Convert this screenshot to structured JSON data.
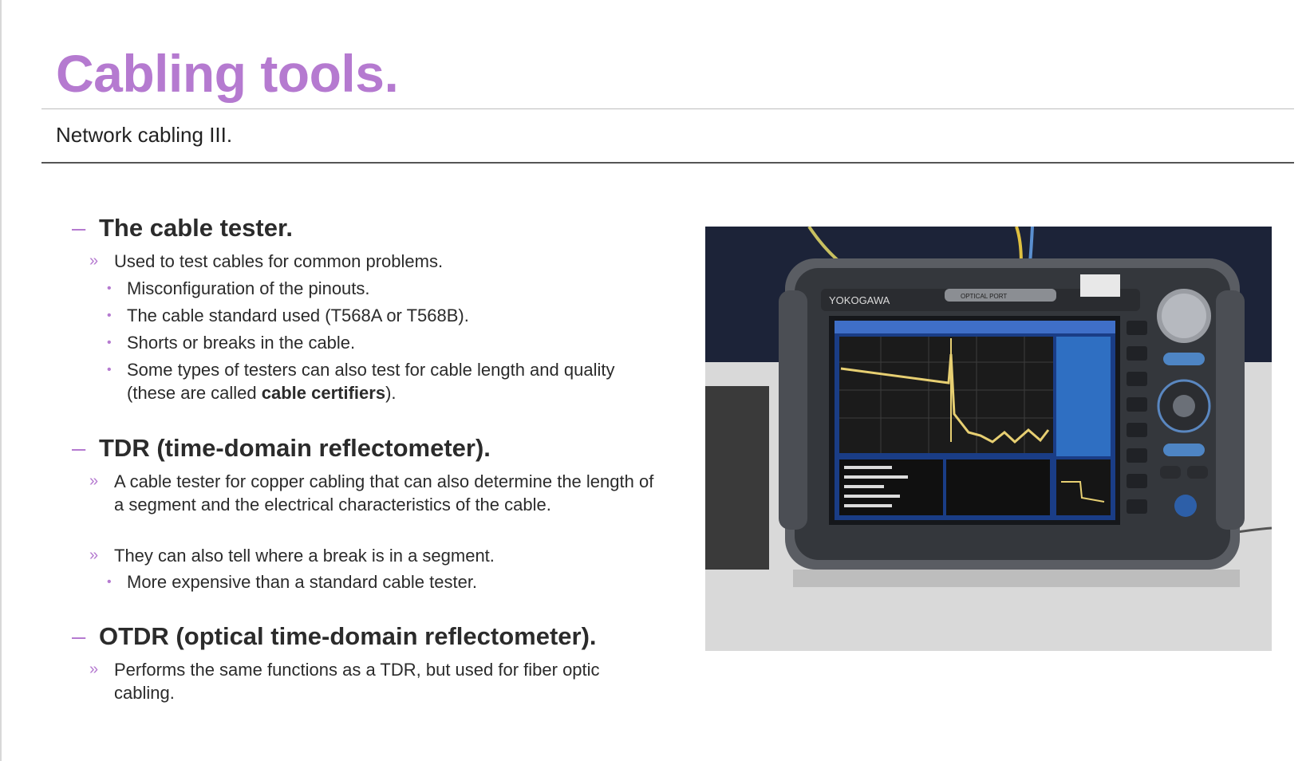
{
  "slide": {
    "title": "Cabling tools.",
    "subtitle": "Network cabling III."
  },
  "sections": [
    {
      "heading": "The cable tester.",
      "items": [
        {
          "text": "Used to test cables for common problems."
        },
        {
          "text": "Misconfiguration of the pinouts."
        },
        {
          "text": "The cable standard used (T568A or T568B)."
        },
        {
          "text": "Shorts or breaks in the cable."
        },
        {
          "text_before": "Some types of testers can also test for cable length and quality (these are called ",
          "text_bold": "cable certifiers",
          "text_after": ")."
        }
      ]
    },
    {
      "heading": "TDR (time-domain reflectometer).",
      "items": [
        {
          "text": "A cable tester for copper cabling that can also determine the length of a segment and the electrical characteristics of the cable."
        },
        {
          "text": "They can also tell where a break is in a segment."
        },
        {
          "text": "More expensive than a standard cable tester."
        }
      ]
    },
    {
      "heading": "OTDR (optical time-domain reflectometer).",
      "items": [
        {
          "text": "Performs the same functions as a TDR, but used for fiber optic cabling."
        }
      ]
    }
  ],
  "markers": {
    "section": "–",
    "level2": "»",
    "level3": "•"
  },
  "photo": {
    "device_brand": "YOKOGAWA",
    "device_label": "OPTICAL PORT"
  },
  "colors": {
    "accent": "#b57ad0",
    "text": "#2b2b2b",
    "screen": "#2a6fb8"
  }
}
